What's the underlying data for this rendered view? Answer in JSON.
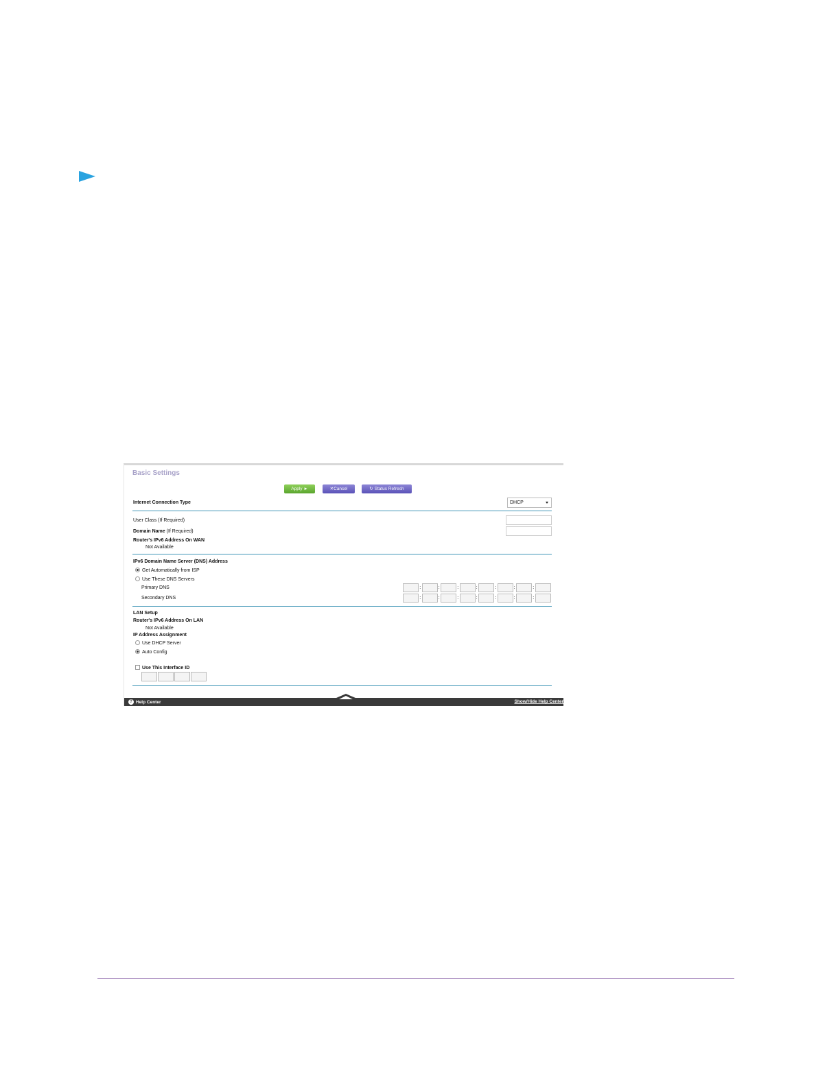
{
  "basic_settings": {
    "title": "Basic Settings",
    "buttons": {
      "apply": "Apply ►",
      "cancel": "Cancel",
      "refresh": "Status Refresh"
    },
    "internet_connection_type": {
      "label": "Internet Connection Type",
      "value": "DHCP"
    },
    "user_class": {
      "label": "User Class (If Required)",
      "value": ""
    },
    "domain_name": {
      "label_bold": "Domain Name",
      "label_rest": " (If Required)",
      "value": ""
    },
    "wan_address": {
      "label": "Router's IPv6 Address On WAN",
      "value": "Not Available"
    },
    "dns": {
      "heading": "IPv6 Domain Name Server (DNS) Address",
      "option_auto": "Get Automatically from ISP",
      "option_manual": "Use These DNS Servers",
      "primary_label": "Primary DNS",
      "secondary_label": "Secondary DNS",
      "selected": "auto"
    },
    "lan": {
      "heading": "LAN Setup",
      "address_label": "Router's IPv6 Address On LAN",
      "address_value": "Not Available",
      "assignment_label": "IP Address Assignment",
      "option_dhcp": "Use DHCP Server",
      "option_auto": "Auto Config",
      "selected": "auto_config",
      "interface_id_label": "Use This Interface ID",
      "interface_id_checked": false
    },
    "footer": {
      "help": "Help Center",
      "toggle": "Show/Hide Help Center"
    }
  },
  "colors": {
    "accent_rule": "#3e95b6",
    "apply_green": "#5aa52e",
    "button_purple": "#5a52b8",
    "title_lavender": "#a9a3c9",
    "arrow_blue": "#29a3e0"
  }
}
